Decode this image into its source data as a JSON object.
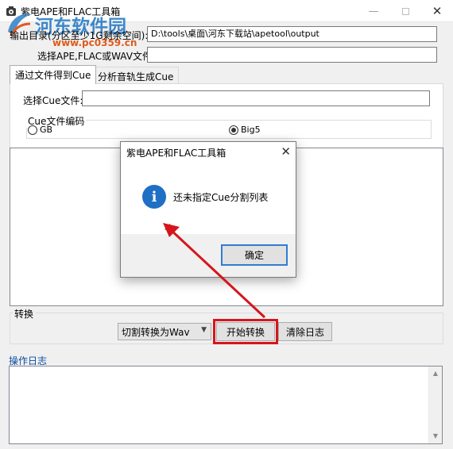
{
  "window": {
    "title": "紫电APE和FLAC工具箱"
  },
  "watermark": {
    "logo_text": "河东软件园",
    "url_text": "www.pc0359.cn"
  },
  "output": {
    "label": "输出目录(分区至少1G剩余空间):",
    "value": "D:\\tools\\桌面\\河东下载站\\apetool\\output"
  },
  "input": {
    "label": "选择APE,FLAC或WAV文件:",
    "value": ""
  },
  "tabs": [
    {
      "label": "通过文件得到Cue",
      "active": true
    },
    {
      "label": "分析音轨生成Cue",
      "active": false
    }
  ],
  "cue": {
    "file_label": "选择Cue文件:",
    "file_value": "",
    "encoding_title": "Cue文件编码",
    "options": [
      {
        "label": "GB",
        "checked": false
      },
      {
        "label": "Big5",
        "checked": true
      }
    ]
  },
  "convert": {
    "group_title": "转换",
    "mode_selected": "切割转换为Wav",
    "start_label": "开始转换",
    "clear_label": "清除日志"
  },
  "log": {
    "title": "操作日志",
    "content": ""
  },
  "dialog": {
    "title": "紫电APE和FLAC工具箱",
    "message": "还未指定Cue分割列表",
    "ok_label": "确定"
  },
  "colors": {
    "accent": "#1f6fc5",
    "highlight": "#d4161c",
    "link": "#0b4ea2",
    "watermark_blue": "#2e7fc7",
    "watermark_orange": "#e05a1a"
  },
  "icons": {
    "app": "app-icon",
    "dialog_info": "info-icon",
    "annotation": "red-arrow-annotation"
  }
}
